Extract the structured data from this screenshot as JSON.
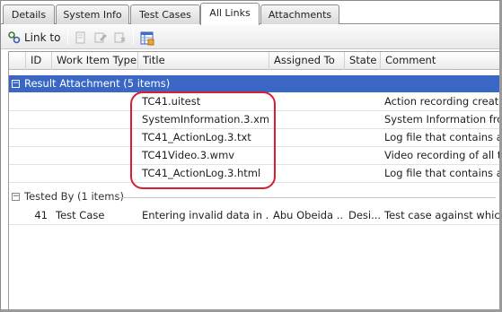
{
  "tabs": [
    {
      "label": "Details",
      "active": false
    },
    {
      "label": "System Info",
      "active": false
    },
    {
      "label": "Test Cases",
      "active": false
    },
    {
      "label": "All Links",
      "active": true
    },
    {
      "label": "Attachments",
      "active": false
    }
  ],
  "toolbar": {
    "link_to_label": "Link to",
    "icons": [
      "link-icon",
      "open-icon",
      "edit-link-icon",
      "delete-link-icon",
      "column-options-icon"
    ]
  },
  "columns": [
    "ID",
    "Work Item Type",
    "Title",
    "Assigned To",
    "State",
    "Comment"
  ],
  "groups": {
    "attachments": {
      "label": "Result Attachment (5 items)",
      "toggle": "−",
      "rows": [
        {
          "id": "",
          "type": "",
          "title": "TC41.uitest",
          "assigned": "",
          "state": "",
          "comment": "Action recording created"
        },
        {
          "id": "",
          "type": "",
          "title": "SystemInformation.3.xml",
          "assigned": "",
          "state": "",
          "comment": "System Information from"
        },
        {
          "id": "",
          "type": "",
          "title": "TC41_ActionLog.3.txt",
          "assigned": "",
          "state": "",
          "comment": "Log file that contains all t"
        },
        {
          "id": "",
          "type": "",
          "title": "TC41Video.3.wmv",
          "assigned": "",
          "state": "",
          "comment": "Video recording of all the"
        },
        {
          "id": "",
          "type": "",
          "title": "TC41_ActionLog.3.html",
          "assigned": "",
          "state": "",
          "comment": "Log file that contains all t"
        }
      ]
    },
    "tested_by": {
      "label": "Tested By (1 items)",
      "toggle": "−",
      "rows": [
        {
          "id": "41",
          "type": "Test Case",
          "title": "Entering invalid data in ...",
          "assigned": "Abu Obeida ...",
          "state": "Desi...",
          "comment": "Test case against which b"
        }
      ]
    }
  },
  "colors": {
    "selection": "#3a67c4",
    "annotation": "#d61f2f"
  }
}
